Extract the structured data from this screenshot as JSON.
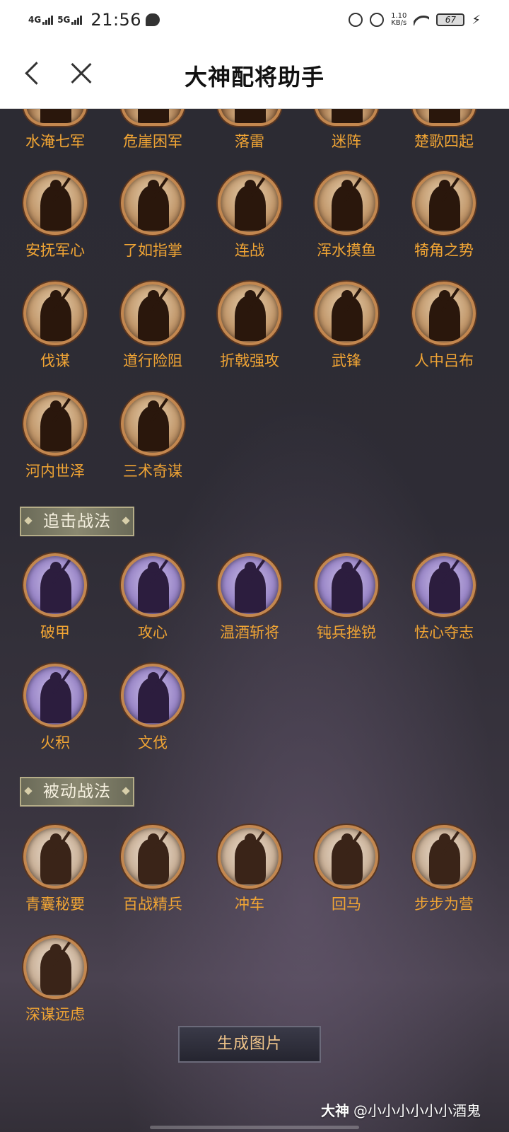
{
  "status_bar": {
    "sim1": "4G",
    "sim2": "5G",
    "time": "21:56",
    "net_speed_value": "1.10",
    "net_speed_unit": "KB/s",
    "battery": "67"
  },
  "header": {
    "title": "大神配将助手"
  },
  "sections": {
    "command_top_row": [
      "水淹七军",
      "危崖困军",
      "落雷",
      "迷阵",
      "楚歌四起"
    ],
    "command_rows": [
      [
        "安抚军心",
        "了如指掌",
        "连战",
        "浑水摸鱼",
        "犄角之势"
      ],
      [
        "伐谋",
        "道行险阻",
        "折戟强攻",
        "武锋",
        "人中吕布"
      ],
      [
        "河内世泽",
        "三术奇谋"
      ]
    ],
    "pursuit": {
      "title": "追击战法",
      "rows": [
        [
          "破甲",
          "攻心",
          "温酒斩将",
          "钝兵挫锐",
          "怯心夺志"
        ],
        [
          "火积",
          "文伐"
        ]
      ]
    },
    "passive": {
      "title": "被动战法",
      "rows": [
        [
          "青囊秘要",
          "百战精兵",
          "冲车",
          "回马",
          "步步为营"
        ],
        [
          "深谋远虑"
        ]
      ]
    }
  },
  "actions": {
    "generate_label": "生成图片"
  },
  "watermark": {
    "brand": "大神",
    "user": "@小小小小小小酒鬼"
  }
}
